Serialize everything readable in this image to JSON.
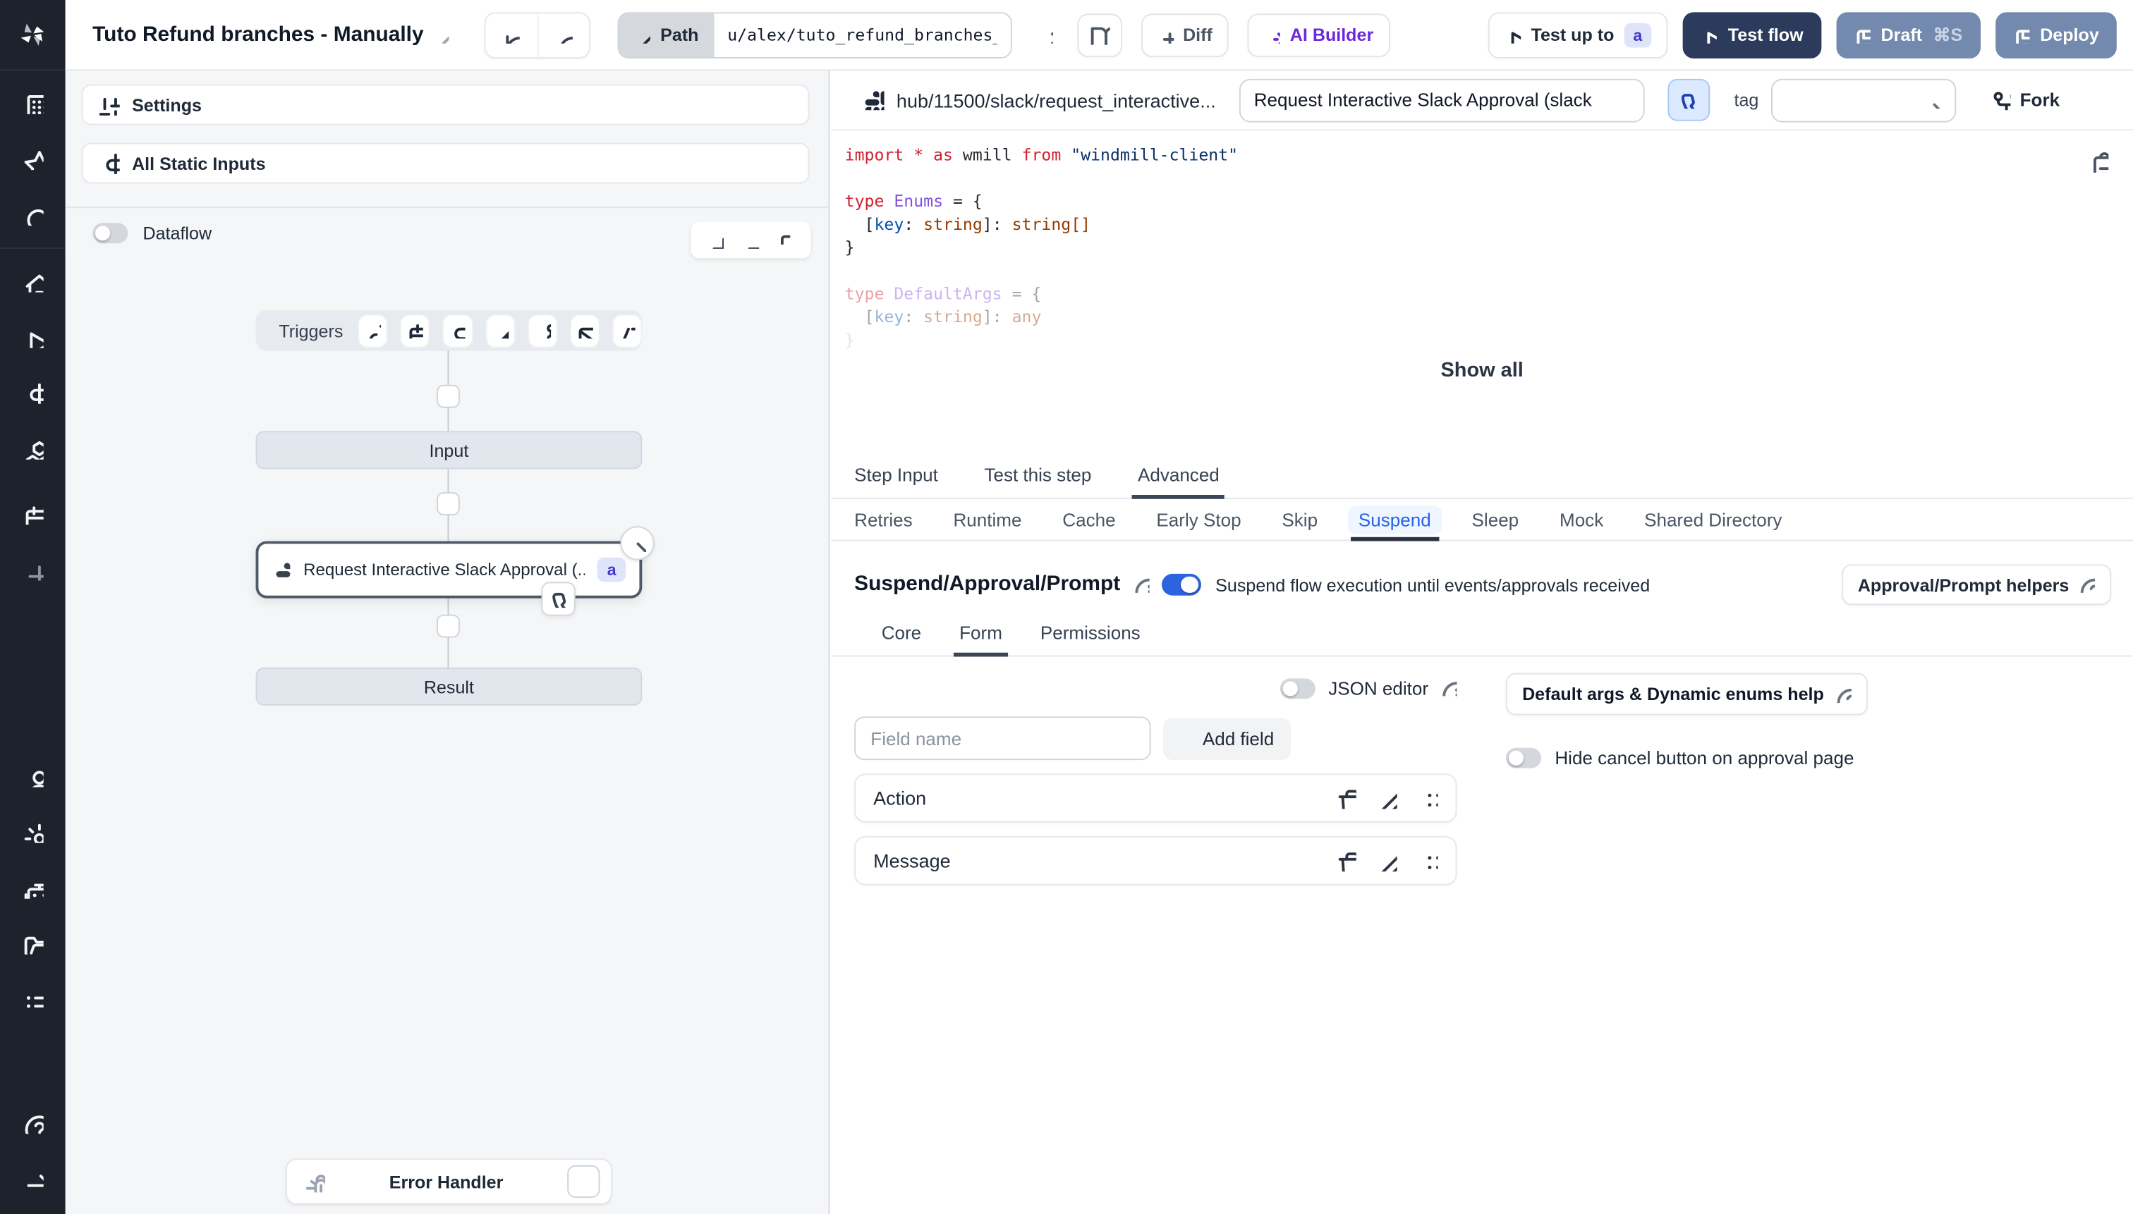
{
  "topbar": {
    "title": "Tuto Refund branches - Manually",
    "path_label": "Path",
    "path_value": "u/alex/tuto_refund_branches__",
    "diff_label": "Diff",
    "ai_builder_label": "AI Builder",
    "test_up_to_label": "Test up to",
    "test_up_to_badge": "a",
    "test_flow_label": "Test flow",
    "draft_label": "Draft",
    "draft_shortcut": "⌘S",
    "deploy_label": "Deploy"
  },
  "flow_panel": {
    "settings_label": "Settings",
    "static_inputs_label": "All Static Inputs",
    "dataflow_label": "Dataflow",
    "triggers_label": "Triggers",
    "input_label": "Input",
    "step_node": {
      "title": "Request Interactive Slack Approval (...",
      "badge": "a"
    },
    "result_label": "Result",
    "error_handler_label": "Error Handler"
  },
  "script_panel": {
    "hub_path": "hub/11500/slack/request_interactive...",
    "summary": "Request Interactive Slack Approval (slack",
    "tag_label": "tag",
    "fork_label": "Fork",
    "show_all_label": "Show all",
    "code": {
      "lines": [
        {
          "fade": 0,
          "tokens": [
            {
              "t": "import",
              "c": "k"
            },
            {
              "t": " ",
              "c": "p"
            },
            {
              "t": "*",
              "c": "k"
            },
            {
              "t": " ",
              "c": "p"
            },
            {
              "t": "as",
              "c": "k"
            },
            {
              "t": " wmill ",
              "c": "p"
            },
            {
              "t": "from",
              "c": "k"
            },
            {
              "t": " ",
              "c": "p"
            },
            {
              "t": "\"windmill-client\"",
              "c": "s"
            }
          ]
        },
        {
          "fade": 0,
          "tokens": []
        },
        {
          "fade": 0,
          "tokens": [
            {
              "t": "type",
              "c": "k"
            },
            {
              "t": " ",
              "c": "p"
            },
            {
              "t": "Enums",
              "c": "t"
            },
            {
              "t": " = {",
              "c": "p"
            }
          ]
        },
        {
          "fade": 0,
          "tokens": [
            {
              "t": "  [",
              "c": "p"
            },
            {
              "t": "key",
              "c": "v"
            },
            {
              "t": ": ",
              "c": "p"
            },
            {
              "t": "string",
              "c": "o"
            },
            {
              "t": "]: ",
              "c": "p"
            },
            {
              "t": "string[]",
              "c": "o"
            }
          ]
        },
        {
          "fade": 0,
          "tokens": [
            {
              "t": "}",
              "c": "p"
            }
          ]
        },
        {
          "fade": 0,
          "tokens": []
        },
        {
          "fade": 1,
          "tokens": [
            {
              "t": "type",
              "c": "k"
            },
            {
              "t": " ",
              "c": "p"
            },
            {
              "t": "DefaultArgs",
              "c": "t"
            },
            {
              "t": " = {",
              "c": "p"
            }
          ]
        },
        {
          "fade": 1,
          "tokens": [
            {
              "t": "  [",
              "c": "p"
            },
            {
              "t": "key",
              "c": "v"
            },
            {
              "t": ": ",
              "c": "p"
            },
            {
              "t": "string",
              "c": "o"
            },
            {
              "t": "]: ",
              "c": "p"
            },
            {
              "t": "any",
              "c": "o"
            }
          ]
        },
        {
          "fade": 2,
          "tokens": [
            {
              "t": "}",
              "c": "p"
            }
          ]
        }
      ]
    }
  },
  "tabs": {
    "main": [
      "Step Input",
      "Test this step",
      "Advanced"
    ],
    "active_main": "Advanced",
    "advanced": [
      "Retries",
      "Runtime",
      "Cache",
      "Early Stop",
      "Skip",
      "Suspend",
      "Sleep",
      "Mock",
      "Shared Directory"
    ],
    "active_advanced": "Suspend"
  },
  "suspend": {
    "title": "Suspend/Approval/Prompt",
    "toggle_on": true,
    "description": "Suspend flow execution until events/approvals received",
    "helpers_label": "Approval/Prompt helpers",
    "subtabs": [
      "Core",
      "Form",
      "Permissions"
    ],
    "active_subtab": "Form",
    "form": {
      "json_editor_label": "JSON editor",
      "field_name_placeholder": "Field name",
      "add_field_label": "Add field",
      "default_args_label": "Default args & Dynamic enums help",
      "hide_cancel_label": "Hide cancel button on approval page",
      "fields": [
        {
          "name": "Action"
        },
        {
          "name": "Message"
        }
      ]
    }
  },
  "colors": {
    "sidebar_bg": "#1d222d",
    "canvas_bg": "#f4f6f8",
    "primary_navy": "#2c3a5c",
    "slate_button": "#7389ad",
    "accent_blue": "#2563eb",
    "badge_bg": "#e0e4fb",
    "badge_text": "#4338ca",
    "ai_purple": "#6d28d9"
  }
}
